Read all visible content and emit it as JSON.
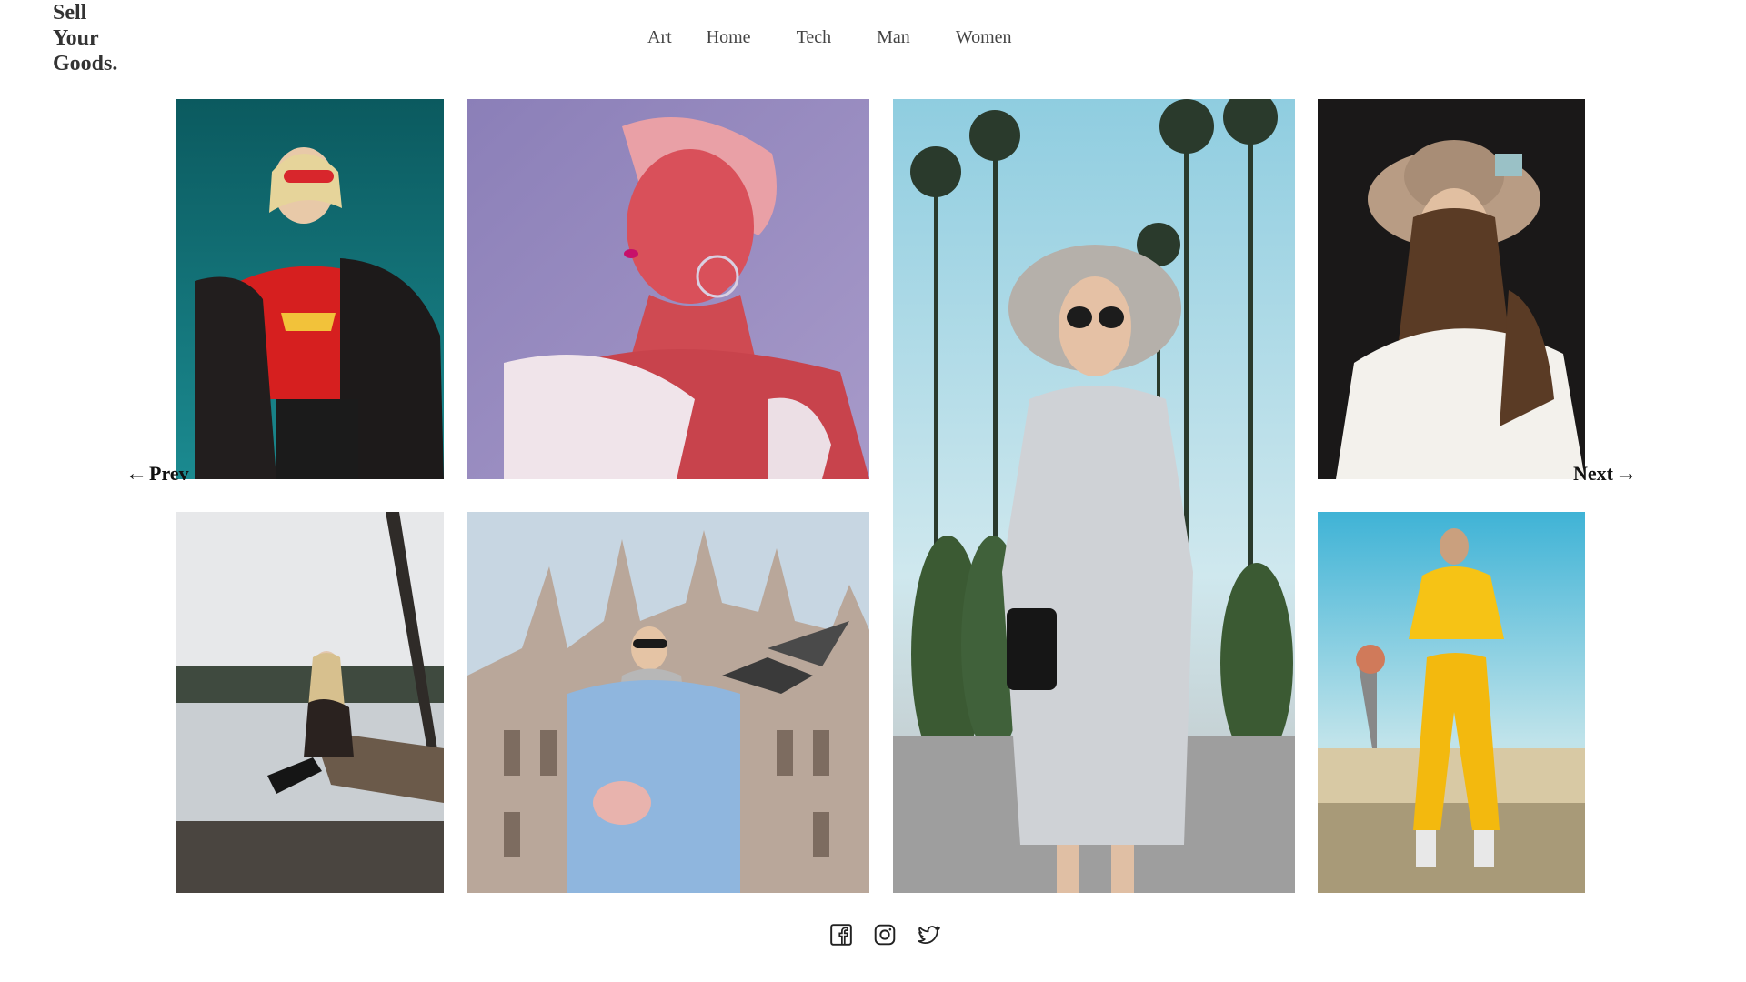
{
  "brand": {
    "line1": "Sell",
    "line2": "Your",
    "line3": "Goods."
  },
  "nav": {
    "items": [
      {
        "label": "Art"
      },
      {
        "label": "Home"
      },
      {
        "label": "Tech"
      },
      {
        "label": "Man"
      },
      {
        "label": "Women"
      }
    ]
  },
  "carousel": {
    "prev_label": "Prev",
    "next_label": "Next",
    "prev_icon": "arrow-left-icon",
    "next_icon": "arrow-right-icon"
  },
  "gallery": {
    "photos": [
      {
        "subject": "woman-red-tshirt-teal-background"
      },
      {
        "subject": "woman-pink-light-off-shoulder"
      },
      {
        "subject": "woman-grey-dress-palm-trees"
      },
      {
        "subject": "woman-beige-hat-white-blouse"
      },
      {
        "subject": "woman-sitting-on-dock-lake"
      },
      {
        "subject": "woman-blue-coat-cathedral-pigeons"
      },
      {
        "subject": "woman-yellow-tracksuit-basketball-hoop"
      }
    ]
  },
  "social": {
    "icons": [
      "facebook-icon",
      "instagram-icon",
      "twitter-icon"
    ]
  },
  "colors": {
    "text": "#333333",
    "nav_text": "#444444",
    "background": "#ffffff"
  }
}
